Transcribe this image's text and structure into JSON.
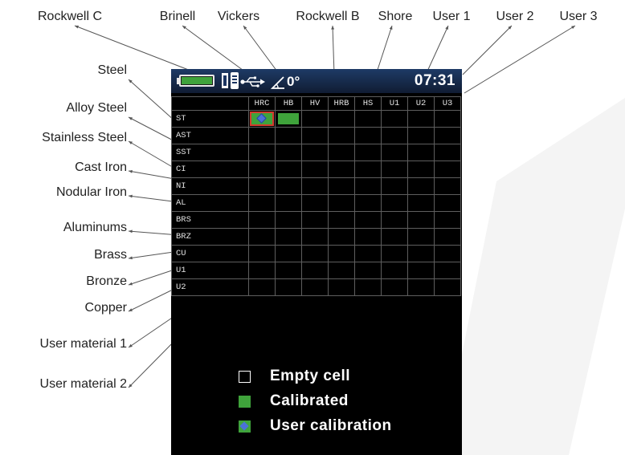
{
  "callouts_top": [
    {
      "key": "hrc",
      "label": "Rockwell C"
    },
    {
      "key": "hb",
      "label": "Brinell"
    },
    {
      "key": "hv",
      "label": "Vickers"
    },
    {
      "key": "hrb",
      "label": "Rockwell B"
    },
    {
      "key": "hs",
      "label": "Shore"
    },
    {
      "key": "u1",
      "label": "User 1"
    },
    {
      "key": "u2",
      "label": "User 2"
    },
    {
      "key": "u3",
      "label": "User 3"
    }
  ],
  "callouts_left": [
    {
      "key": "st",
      "label": "Steel"
    },
    {
      "key": "ast",
      "label": "Alloy Steel"
    },
    {
      "key": "sst",
      "label": "Stainless Steel"
    },
    {
      "key": "ci",
      "label": "Cast Iron"
    },
    {
      "key": "ni",
      "label": "Nodular Iron"
    },
    {
      "key": "al",
      "label": "Aluminums"
    },
    {
      "key": "brs",
      "label": "Brass"
    },
    {
      "key": "brz",
      "label": "Bronze"
    },
    {
      "key": "cu",
      "label": "Copper"
    },
    {
      "key": "um1",
      "label": "User material 1"
    },
    {
      "key": "um2",
      "label": "User material 2"
    }
  ],
  "status_bar": {
    "battery_level": 1.0,
    "battery_color": "#3fa33b",
    "probe_icon": "probe-icon",
    "usb_icon": "usb-icon",
    "angle_icon": "angle-icon",
    "angle": "0°",
    "time": "07:31"
  },
  "grid": {
    "columns": [
      "HRC",
      "HB",
      "HV",
      "HRB",
      "HS",
      "U1",
      "U2",
      "U3"
    ],
    "rows": [
      "ST",
      "AST",
      "SST",
      "CI",
      "NI",
      "AL",
      "BRS",
      "BRZ",
      "CU",
      "U1",
      "U2"
    ],
    "cells": {
      "ST": [
        "user",
        "calibrated",
        "empty",
        "empty",
        "empty",
        "empty",
        "empty",
        "empty"
      ]
    }
  },
  "legend": [
    {
      "type": "empty",
      "label": "Empty cell"
    },
    {
      "type": "calibrated",
      "label": "Calibrated"
    },
    {
      "type": "user",
      "label": "User calibration"
    }
  ],
  "colors": {
    "screen_background": "#000000",
    "calibrated": "#3fa33b",
    "user_marker": "#4b72d8",
    "user_border": "#d43b2e",
    "grid_line": "#5e5e5e",
    "status_bar": "#1e3b66"
  }
}
